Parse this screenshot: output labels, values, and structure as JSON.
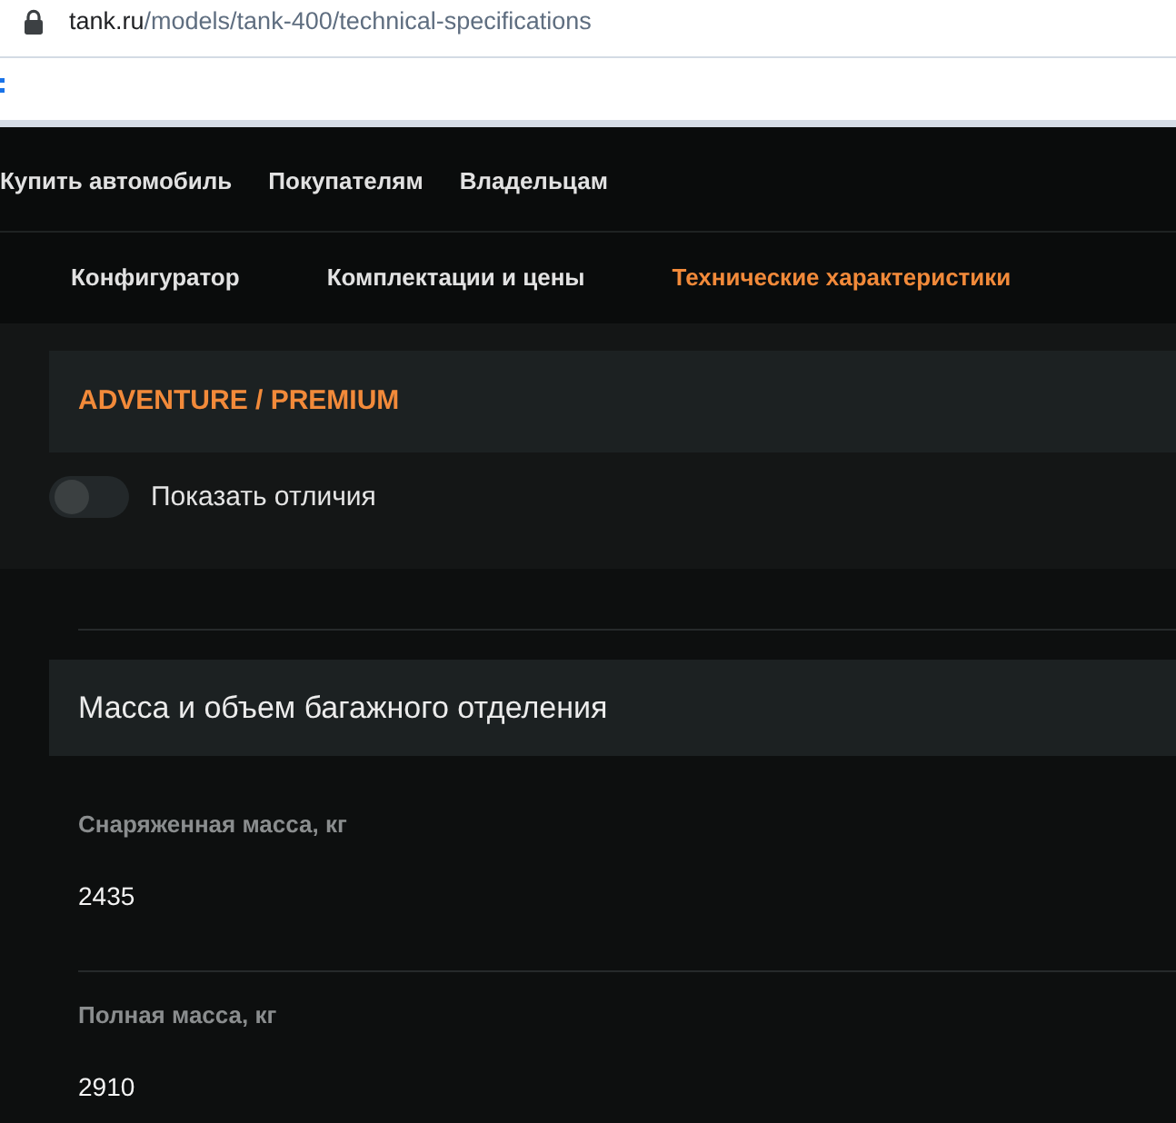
{
  "browser": {
    "url_host": "tank.ru",
    "url_path": "/models/tank-400/technical-specifications"
  },
  "main_nav": [
    {
      "label": "Купить автомобиль"
    },
    {
      "label": "Покупателям"
    },
    {
      "label": "Владельцам"
    }
  ],
  "sub_nav": [
    {
      "label": "Конфигуратор",
      "selected": false
    },
    {
      "label": "Комплектации и цены",
      "selected": false
    },
    {
      "label": "Технические характеристики",
      "selected": true
    }
  ],
  "trim": {
    "title": "ADVENTURE / PREMIUM"
  },
  "diff_toggle": {
    "label": "Показать отличия",
    "on": false
  },
  "section": {
    "title": "Масса и объем багажного отделения",
    "specs": [
      {
        "label": "Снаряженная масса, кг",
        "value": "2435"
      },
      {
        "label": "Полная масса, кг",
        "value": "2910"
      }
    ]
  }
}
